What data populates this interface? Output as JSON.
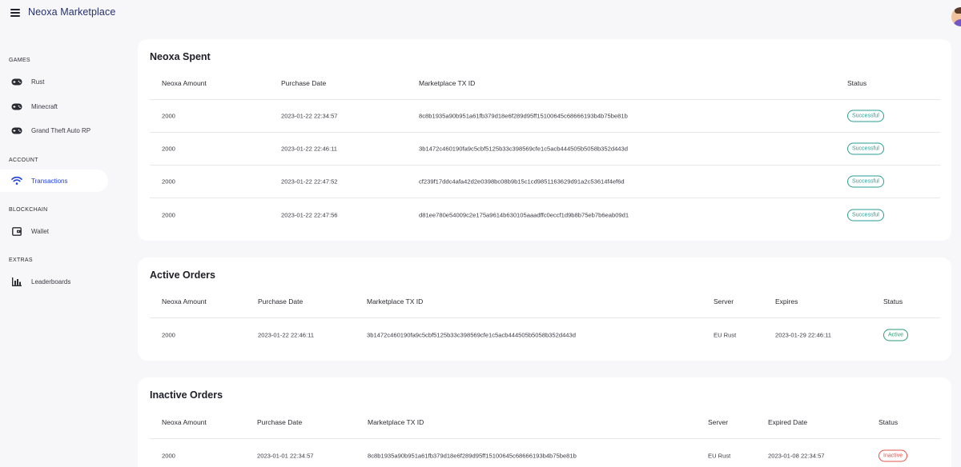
{
  "header": {
    "title": "Neoxa Marketplace"
  },
  "sidebar": {
    "sections": [
      {
        "label": "GAMES",
        "items": [
          {
            "label": "Rust",
            "icon": "gamepad-icon"
          },
          {
            "label": "Minecraft",
            "icon": "gamepad-icon"
          },
          {
            "label": "Grand Theft Auto RP",
            "icon": "gamepad-icon"
          }
        ]
      },
      {
        "label": "ACCOUNT",
        "items": [
          {
            "label": "Transactions",
            "icon": "wifi-icon",
            "active": true
          }
        ]
      },
      {
        "label": "BLOCKCHAIN",
        "items": [
          {
            "label": "Wallet",
            "icon": "wallet-icon"
          }
        ]
      },
      {
        "label": "EXTRAS",
        "items": [
          {
            "label": "Leaderboards",
            "icon": "bar-chart-icon"
          }
        ]
      }
    ]
  },
  "spent": {
    "title": "Neoxa Spent",
    "headers": [
      "Neoxa Amount",
      "Purchase Date",
      "Marketplace TX ID",
      "Status"
    ],
    "rows": [
      [
        "2000",
        "2023-01-22 22:34:57",
        "8c8b1935a90b951a61fb379d18e6f289d95ff15100645c68666193b4b75be81b",
        "Successful"
      ],
      [
        "2000",
        "2023-01-22 22:46:11",
        "3b1472c460190fa9c5cbf5125b33c398569cfe1c5acb444505b5058b352d443d",
        "Successful"
      ],
      [
        "2000",
        "2023-01-22 22:47:52",
        "cf239f17ddc4afa42d2e0398bc08b9b15c1cd9851163629d91a2c53614f4ef6d",
        "Successful"
      ],
      [
        "2000",
        "2023-01-22 22:47:56",
        "d81ee780e54009c2e175a9614b630105aaadffc0eccf1d9b8b75eb7b6eab09d1",
        "Successful"
      ]
    ]
  },
  "active": {
    "title": "Active Orders",
    "headers": [
      "Neoxa Amount",
      "Purchase Date",
      "Marketplace TX ID",
      "Server",
      "Expires",
      "Status"
    ],
    "rows": [
      [
        "2000",
        "2023-01-22 22:46:11",
        "3b1472c460190fa9c5cbf5125b33c398569cfe1c5acb444505b5058b352d443d",
        "EU Rust",
        "2023-01-29 22:46:11",
        "Active"
      ]
    ]
  },
  "inactive": {
    "title": "Inactive Orders",
    "headers": [
      "Neoxa Amount",
      "Purchase Date",
      "Marketplace TX ID",
      "Server",
      "Expired Date",
      "Status"
    ],
    "rows": [
      [
        "2000",
        "2023-01-01 22:34:57",
        "8c8b1935a90b951a61fb379d18e6f289d95ff15100645c68666193b4b75be81b",
        "EU Rust",
        "2023-01-08 22:34:57",
        "Inactive"
      ]
    ]
  },
  "colors": {
    "accent": "#1f3fd6",
    "success": "#2a9e94",
    "active": "#2a9e72",
    "inactive": "#e0534a"
  }
}
